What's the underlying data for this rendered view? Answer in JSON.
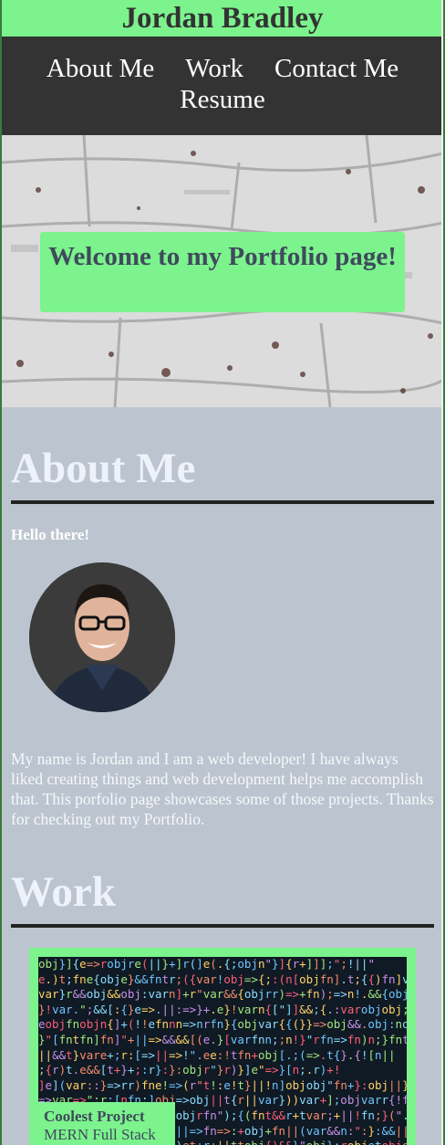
{
  "header": {
    "title": "Jordan Bradley"
  },
  "nav": {
    "items": [
      {
        "label": "About Me"
      },
      {
        "label": "Work"
      },
      {
        "label": "Contact Me"
      },
      {
        "label": "Resume"
      }
    ]
  },
  "hero": {
    "heading": "Welcome to my Portfolio page!"
  },
  "about": {
    "title": "About Me",
    "greeting": "Hello there!",
    "bio": "My name is Jordan and I am a web developer! I have always liked creating things and web development helps me accomplish that. This porfolio page showcases some of those projects. Thanks for checking out my Portfolio."
  },
  "work": {
    "title": "Work",
    "projects": [
      {
        "title": "Coolest Project",
        "subtitle": "MERN Full Stack"
      }
    ]
  },
  "colors": {
    "accent": "#7cf38d",
    "nav_bg": "#333333",
    "page_bg": "#bcc5cf"
  }
}
